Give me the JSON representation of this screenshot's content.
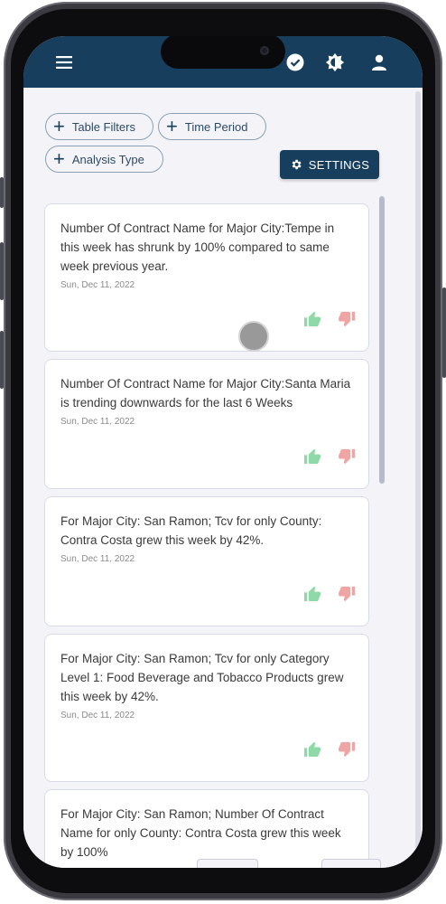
{
  "colors": {
    "header": "#173e5c",
    "accent": "#173e5c",
    "like": "#8fd9a8",
    "dislike": "#f0a5a5"
  },
  "header": {
    "icons": [
      "menu-icon",
      "check-circle-icon",
      "brightness-icon",
      "user-icon"
    ]
  },
  "filters": [
    {
      "label": "Table Filters"
    },
    {
      "label": "Time Period"
    },
    {
      "label": "Analysis Type"
    }
  ],
  "settings": {
    "label": "SETTINGS"
  },
  "cards": [
    {
      "text": "Number Of Contract Name for Major City:Tempe in this week has shrunk by 100% compared to same week previous year.",
      "date": "Sun, Dec 11, 2022"
    },
    {
      "text": "Number Of Contract Name for Major City:Santa Maria is trending downwards for the last 6 Weeks",
      "date": "Sun, Dec 11, 2022"
    },
    {
      "text": "For Major City: San Ramon; Tcv for only County: Contra Costa grew this week by 42%.",
      "date": "Sun, Dec 11, 2022"
    },
    {
      "text": "For Major City: San Ramon; Tcv for only Category Level 1: Food Beverage and Tobacco Products grew this week by 42%.",
      "date": "Sun, Dec 11, 2022"
    },
    {
      "text": "For Major City: San Ramon; Number Of Contract Name for only County: Contra Costa grew this week by 100%",
      "date": ""
    }
  ]
}
